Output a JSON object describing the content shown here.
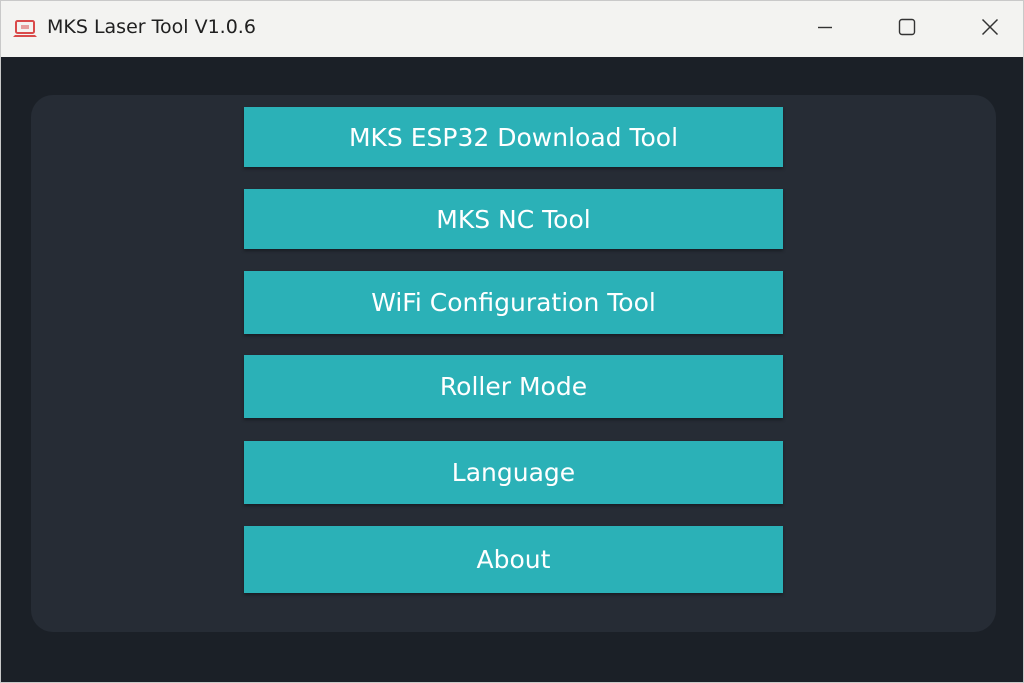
{
  "window": {
    "title": "MKS Laser Tool V1.0.6",
    "app_icon": "laptop-icon",
    "controls": {
      "minimize_icon": "minimize-icon",
      "maximize_icon": "maximize-icon",
      "close_icon": "close-icon"
    }
  },
  "menu": {
    "items": [
      {
        "label": "MKS ESP32 Download Tool"
      },
      {
        "label": "MKS NC Tool"
      },
      {
        "label": "WiFi Configuration Tool"
      },
      {
        "label": "Roller Mode"
      },
      {
        "label": "Language"
      },
      {
        "label": "About"
      }
    ]
  },
  "colors": {
    "accent": "#2bb1b7",
    "background": "#1b2027",
    "panel": "#262c35",
    "titlebar": "#f3f3f1",
    "app_icon": "#d94a4a"
  }
}
